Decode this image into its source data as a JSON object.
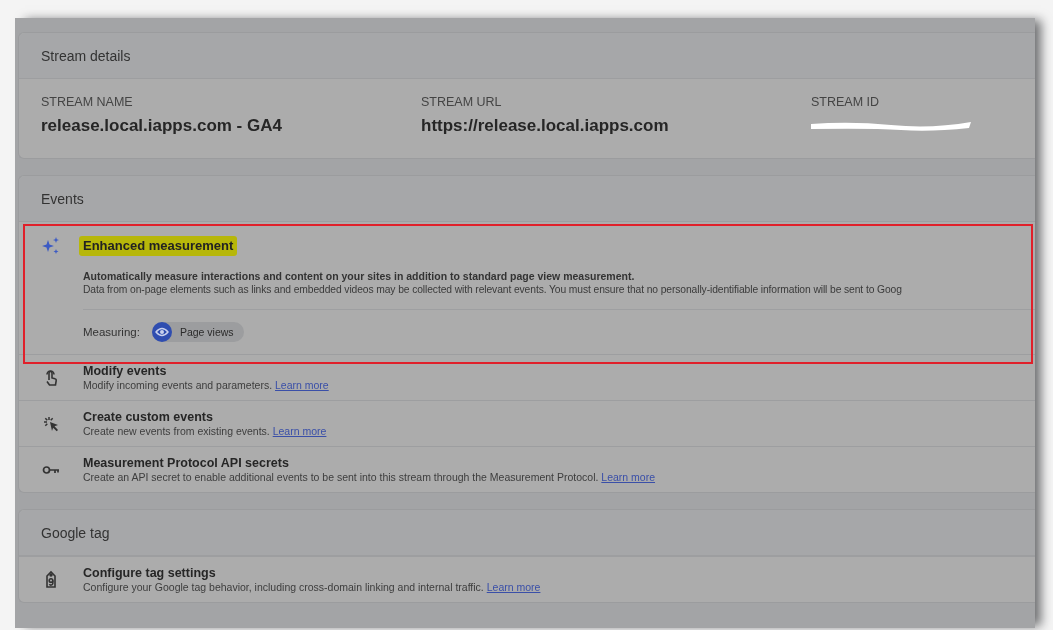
{
  "stream_details": {
    "title": "Stream details",
    "fields": [
      {
        "label": "STREAM NAME",
        "value": "release.local.iapps.com - GA4",
        "redacted": false
      },
      {
        "label": "STREAM URL",
        "value": "https://release.local.iapps.com",
        "redacted": false
      },
      {
        "label": "STREAM ID",
        "redacted": true
      }
    ]
  },
  "events": {
    "title": "Events",
    "enhanced": {
      "title": "Enhanced measurement",
      "highlighted": true,
      "annotated": true,
      "summary": "Automatically measure interactions and content on your sites in addition to standard page view measurement.",
      "detail": "Data from on-page elements such as links and embedded videos may be collected with relevant events. You must ensure that no personally-identifiable information will be sent to Goog",
      "measuring_label": "Measuring:",
      "chips": [
        {
          "label": "Page views"
        }
      ]
    },
    "rows": [
      {
        "kind": "touch",
        "title": "Modify events",
        "description": "Modify incoming events and parameters.",
        "link": "Learn more"
      },
      {
        "kind": "click",
        "title": "Create custom events",
        "description": "Create new events from existing events.",
        "link": "Learn more"
      },
      {
        "kind": "key",
        "title": "Measurement Protocol API secrets",
        "description": "Create an API secret to enable additional events to be sent into this stream through the Measurement Protocol.",
        "link": "Learn more"
      }
    ]
  },
  "google_tag": {
    "title": "Google tag",
    "rows": [
      {
        "kind": "tag",
        "title": "Configure tag settings",
        "description": "Configure your Google tag behavior, including cross-domain linking and internal traffic.",
        "link": "Learn more"
      }
    ]
  }
}
